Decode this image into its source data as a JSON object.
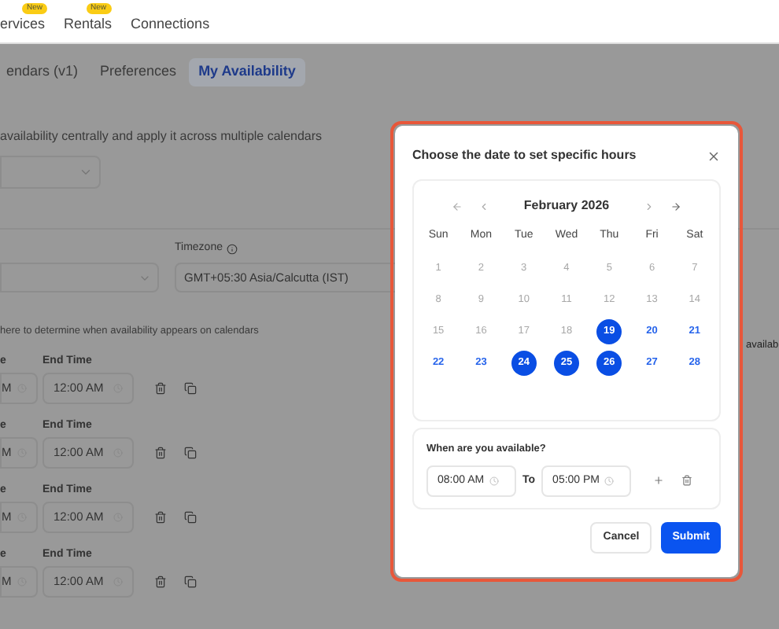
{
  "nav": [
    {
      "label": "ervices",
      "badge": "New"
    },
    {
      "label": "Rentals",
      "badge": "New"
    },
    {
      "label": "Connections"
    }
  ],
  "tabs": [
    {
      "label": "endars (v1)",
      "selected": false
    },
    {
      "label": "Preferences",
      "selected": false
    },
    {
      "label": "My Availability",
      "selected": true
    }
  ],
  "description": "availability centrally and apply it across multiple calendars",
  "timezone": {
    "label": "Timezone",
    "value": "GMT+05:30 Asia/Calcutta (IST)"
  },
  "note": "here to determine when availability appears on calendars",
  "rows": [
    {
      "start_label": "e",
      "start_value": "M",
      "end_label": "End Time",
      "end_value": "12:00 AM"
    },
    {
      "start_label": "e",
      "start_value": "M",
      "end_label": "End Time",
      "end_value": "12:00 AM"
    },
    {
      "start_label": "e",
      "start_value": "M",
      "end_label": "End Time",
      "end_value": "12:00 AM"
    },
    {
      "start_label": "e",
      "start_value": "M",
      "end_label": "End Time",
      "end_value": "12:00 AM"
    }
  ],
  "side_text": "availab",
  "modal": {
    "title": "Choose the date to set specific hours",
    "calendar": {
      "month": "February 2026",
      "weekdays": [
        "Sun",
        "Mon",
        "Tue",
        "Wed",
        "Thu",
        "Fri",
        "Sat"
      ],
      "days": [
        {
          "label": "1",
          "disabled": true,
          "selected": false
        },
        {
          "label": "2",
          "disabled": true,
          "selected": false
        },
        {
          "label": "3",
          "disabled": true,
          "selected": false
        },
        {
          "label": "4",
          "disabled": true,
          "selected": false
        },
        {
          "label": "5",
          "disabled": true,
          "selected": false
        },
        {
          "label": "6",
          "disabled": true,
          "selected": false
        },
        {
          "label": "7",
          "disabled": true,
          "selected": false
        },
        {
          "label": "8",
          "disabled": true,
          "selected": false
        },
        {
          "label": "9",
          "disabled": true,
          "selected": false
        },
        {
          "label": "10",
          "disabled": true,
          "selected": false
        },
        {
          "label": "11",
          "disabled": true,
          "selected": false
        },
        {
          "label": "12",
          "disabled": true,
          "selected": false
        },
        {
          "label": "13",
          "disabled": true,
          "selected": false
        },
        {
          "label": "14",
          "disabled": true,
          "selected": false
        },
        {
          "label": "15",
          "disabled": true,
          "selected": false
        },
        {
          "label": "16",
          "disabled": true,
          "selected": false
        },
        {
          "label": "17",
          "disabled": true,
          "selected": false
        },
        {
          "label": "18",
          "disabled": true,
          "selected": false
        },
        {
          "label": "19",
          "disabled": false,
          "selected": true
        },
        {
          "label": "20",
          "disabled": false,
          "selected": false
        },
        {
          "label": "21",
          "disabled": false,
          "selected": false
        },
        {
          "label": "22",
          "disabled": false,
          "selected": false
        },
        {
          "label": "23",
          "disabled": false,
          "selected": false
        },
        {
          "label": "24",
          "disabled": false,
          "selected": true
        },
        {
          "label": "25",
          "disabled": false,
          "selected": true
        },
        {
          "label": "26",
          "disabled": false,
          "selected": true
        },
        {
          "label": "27",
          "disabled": false,
          "selected": false
        },
        {
          "label": "28",
          "disabled": false,
          "selected": false
        }
      ]
    },
    "availability": {
      "label": "When are you available?",
      "from": "08:00 AM",
      "to_label": "To",
      "to": "05:00 PM"
    },
    "buttons": {
      "cancel": "Cancel",
      "submit": "Submit"
    }
  }
}
